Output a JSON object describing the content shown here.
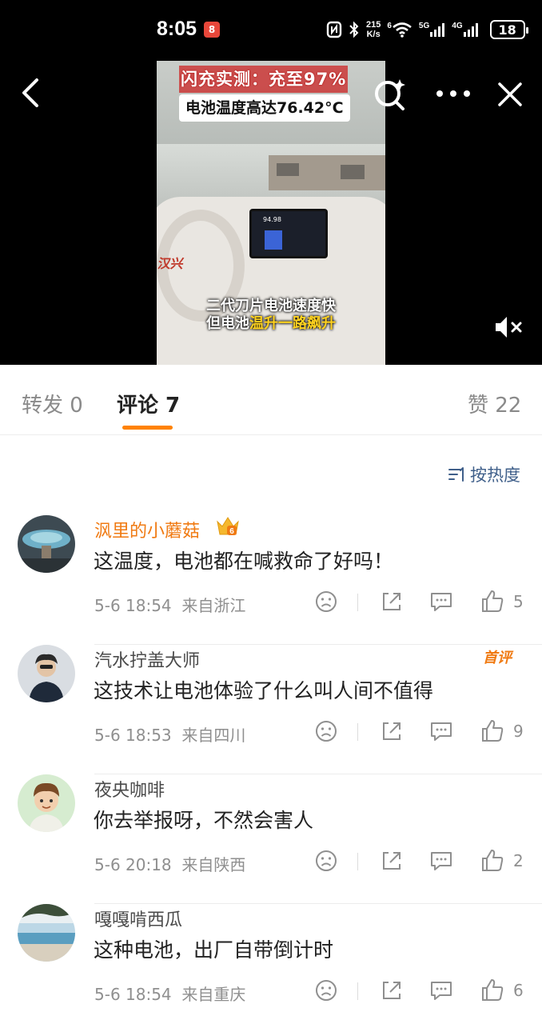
{
  "status_bar": {
    "time": "8:05",
    "notif_badge": "8",
    "speed_top": "215",
    "speed_bottom": "K/s",
    "wifi_num": "6",
    "sig1_label": "5G",
    "sig2_label": "4G",
    "battery": "18"
  },
  "video": {
    "title_line1": "闪充实测：充至97%",
    "title_line2": "电池温度高达76.42°C",
    "caption_line1": "二代刀片电池速度快",
    "caption_line2_prefix": "但电池",
    "caption_line2_highlight": "温升一路飙升",
    "dash_logo": "汉兴",
    "screen_readout": "94.98",
    "muted": true
  },
  "tabs": {
    "repost": "转发 0",
    "comments": "评论 7",
    "likes": "赞 22",
    "active": "comments"
  },
  "sort": {
    "label": "按热度"
  },
  "comments": [
    {
      "name": "沨里的小蘑菇",
      "name_color": "#f07a12",
      "crown": "6",
      "text": "这温度，电池都在喊救命了好吗！",
      "time": "5-6 18:54",
      "location": "来自浙江",
      "likes": "5",
      "badge": ""
    },
    {
      "name": "汽水拧盖大师",
      "name_color": "#4a4a4a",
      "crown": "",
      "text": "这技术让电池体验了什么叫人间不值得",
      "time": "5-6 18:53",
      "location": "来自四川",
      "likes": "9",
      "badge": "首评"
    },
    {
      "name": "夜央咖啡",
      "name_color": "#4a4a4a",
      "crown": "",
      "text": "你去举报呀，不然会害人",
      "time": "5-6 20:18",
      "location": "来自陕西",
      "likes": "2",
      "badge": ""
    },
    {
      "name": "嘎嘎啃西瓜",
      "name_color": "#4a4a4a",
      "crown": "",
      "text": "这种电池，出厂自带倒计时",
      "time": "5-6 18:54",
      "location": "来自重庆",
      "likes": "6",
      "badge": ""
    }
  ],
  "icons": {
    "back": "chevron-left-icon",
    "search": "ai-search-icon",
    "more": "more-dots-icon",
    "close": "close-icon",
    "mute": "speaker-muted-icon",
    "sort": "sort-icon",
    "dislike": "frown-face-icon",
    "share": "share-icon",
    "reply": "comment-bubble-icon",
    "like": "thumbs-up-icon"
  },
  "colors": {
    "accent": "#ff8200",
    "vip_name": "#f07a12",
    "sort_text": "#3f5f8a",
    "meta_text": "#8f8f8f"
  }
}
